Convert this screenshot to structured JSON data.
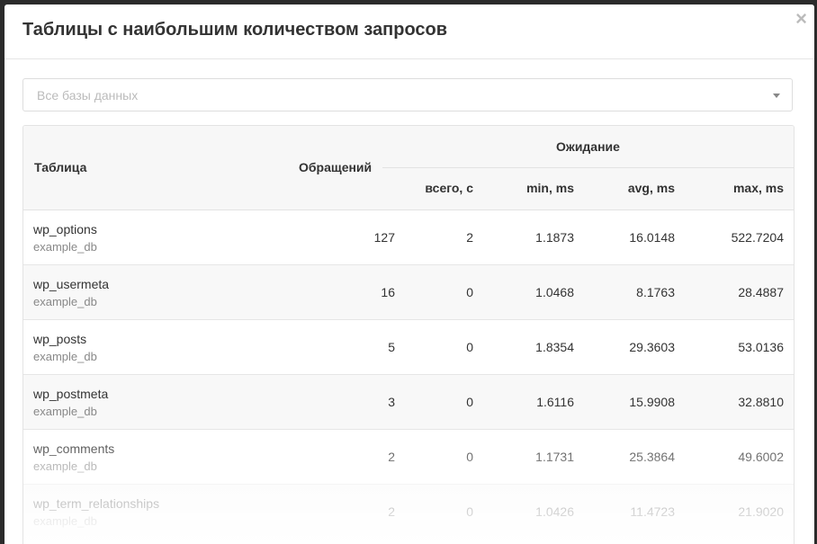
{
  "modal": {
    "title": "Таблицы с наибольшим количеством запросов",
    "close_icon": "×"
  },
  "filter": {
    "placeholder": "Все базы данных"
  },
  "table": {
    "headers": {
      "table": "Таблица",
      "calls": "Обращений",
      "wait_group": "Ожидание",
      "total": "всего, с",
      "min": "min, ms",
      "avg": "avg, ms",
      "max": "max, ms"
    },
    "rows": [
      {
        "name": "wp_options",
        "db": "example_db",
        "calls": "127",
        "total": "2",
        "min": "1.1873",
        "avg": "16.0148",
        "max": "522.7204"
      },
      {
        "name": "wp_usermeta",
        "db": "example_db",
        "calls": "16",
        "total": "0",
        "min": "1.0468",
        "avg": "8.1763",
        "max": "28.4887"
      },
      {
        "name": "wp_posts",
        "db": "example_db",
        "calls": "5",
        "total": "0",
        "min": "1.8354",
        "avg": "29.3603",
        "max": "53.0136"
      },
      {
        "name": "wp_postmeta",
        "db": "example_db",
        "calls": "3",
        "total": "0",
        "min": "1.6116",
        "avg": "15.9908",
        "max": "32.8810"
      },
      {
        "name": "wp_comments",
        "db": "example_db",
        "calls": "2",
        "total": "0",
        "min": "1.1731",
        "avg": "25.3864",
        "max": "49.6002"
      },
      {
        "name": "wp_term_relationships",
        "db": "example_db",
        "calls": "2",
        "total": "0",
        "min": "1.0426",
        "avg": "11.4723",
        "max": "21.9020"
      }
    ]
  }
}
